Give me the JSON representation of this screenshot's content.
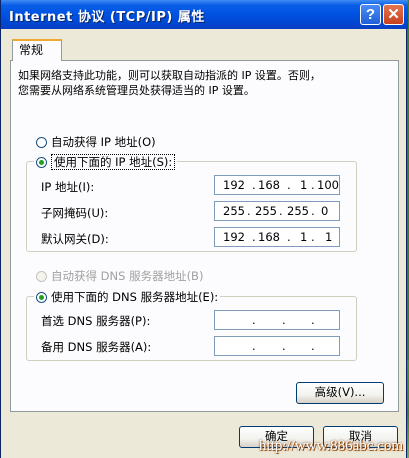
{
  "window": {
    "title": "Internet 协议 (TCP/IP) 属性",
    "help_label": "?",
    "close_label": "✕"
  },
  "tabs": [
    {
      "label": "常规"
    }
  ],
  "description": "如果网络支持此功能，则可以获取自动指派的 IP 设置。否则，\n您需要从网络系统管理员处获得适当的 IP 设置。",
  "ip_section": {
    "auto_label": "自动获得 IP 地址(O)",
    "manual_label": "使用下面的 IP 地址(S):",
    "selected": "manual",
    "fields": [
      {
        "label": "IP 地址(I):",
        "octets": [
          "192",
          "168",
          "1",
          "100"
        ]
      },
      {
        "label": "子网掩码(U):",
        "octets": [
          "255",
          "255",
          "255",
          "0"
        ]
      },
      {
        "label": "默认网关(D):",
        "octets": [
          "192",
          "168",
          "1",
          "1"
        ]
      }
    ]
  },
  "dns_section": {
    "auto_label": "自动获得 DNS 服务器地址(B)",
    "manual_label": "使用下面的 DNS 服务器地址(E):",
    "selected": "manual",
    "auto_disabled": true,
    "fields": [
      {
        "label": "首选 DNS 服务器(P):",
        "octets": [
          "",
          "",
          "",
          ""
        ]
      },
      {
        "label": "备用 DNS 服务器(A):",
        "octets": [
          "",
          "",
          "",
          ""
        ]
      }
    ]
  },
  "buttons": {
    "advanced": "高级(V)...",
    "ok": "确定",
    "cancel": "取消"
  },
  "watermark": "http://www.886abc.com",
  "colors": {
    "titlebar": "#0054e3",
    "dialog_bg": "#ece9d8",
    "radio_dot": "#21a121",
    "tab_highlight": "#f0a830"
  }
}
